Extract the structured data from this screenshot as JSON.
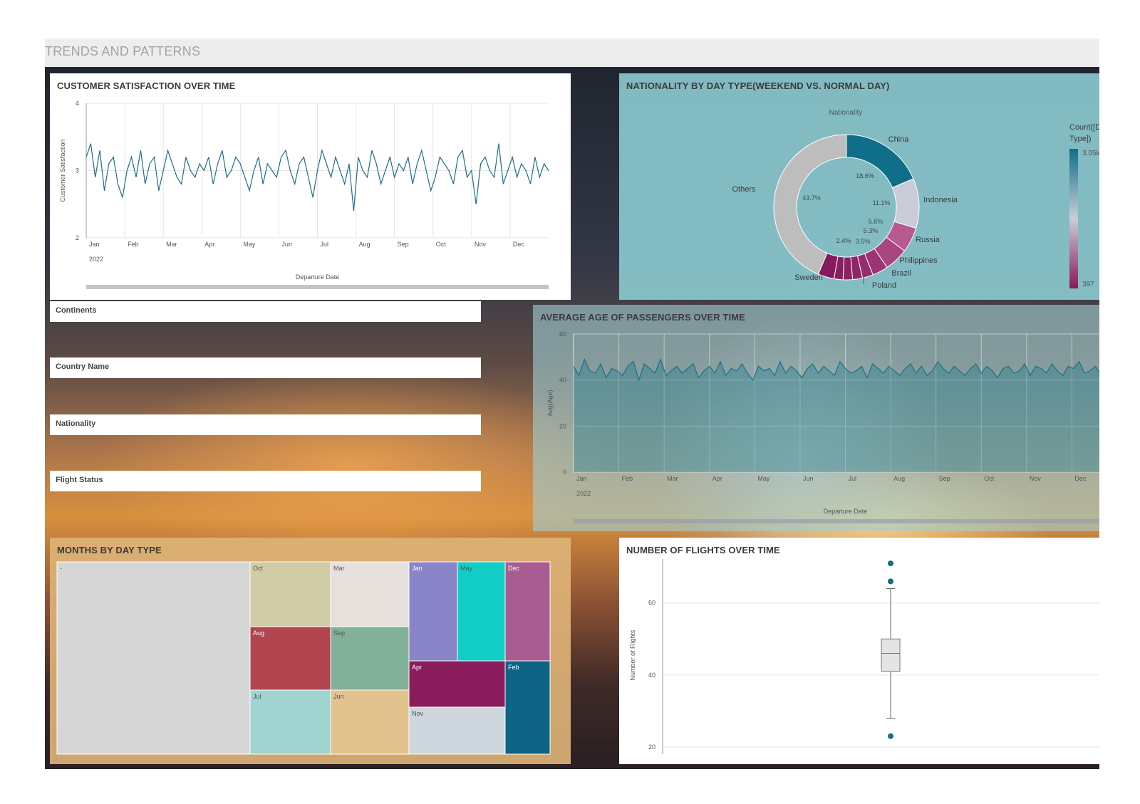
{
  "header": {
    "title": "TRENDS AND PATTERNS"
  },
  "filters": [
    {
      "label": "Continents"
    },
    {
      "label": "Country Name"
    },
    {
      "label": "Nationality"
    },
    {
      "label": "Flight Status"
    }
  ],
  "colors": {
    "accent": "#0f6f8a",
    "magenta": "#8a1a5a",
    "panel_teal": "#8ac8cd",
    "treemap_bg": "#ddb276"
  },
  "chart_data": [
    {
      "id": "customer_satisfaction",
      "type": "line",
      "title": "CUSTOMER SATISFACTION OVER TIME",
      "xlabel": "Departure Date",
      "ylabel": "Customer Satisfaction",
      "x_ticks": [
        "Jan",
        "Feb",
        "Mar",
        "Apr",
        "May",
        "Jun",
        "Jul",
        "Aug",
        "Sep",
        "Oct",
        "Nov",
        "Dec"
      ],
      "x_year": "2022",
      "y_ticks": [
        2,
        3,
        4
      ],
      "ylim": [
        2,
        4
      ],
      "grid": true,
      "series": [
        {
          "values": [
            3.2,
            3.4,
            2.9,
            3.3,
            2.7,
            3.1,
            3.2,
            2.8,
            2.6,
            3.0,
            3.2,
            2.9,
            3.3,
            2.8,
            3.1,
            3.2,
            2.7,
            3.0,
            3.3,
            3.1,
            2.9,
            2.8,
            3.2,
            3.0,
            2.9,
            3.1,
            3.0,
            3.2,
            2.8,
            3.1,
            3.3,
            2.9,
            3.0,
            3.2,
            3.1,
            2.9,
            2.7,
            3.0,
            3.2,
            2.8,
            3.1,
            3.0,
            2.9,
            3.2,
            3.3,
            3.0,
            2.8,
            3.1,
            3.2,
            2.9,
            2.6,
            3.0,
            3.3,
            3.1,
            2.9,
            3.2,
            3.0,
            2.8,
            3.1,
            2.4,
            3.2,
            3.0,
            2.9,
            3.3,
            3.1,
            2.8,
            3.0,
            3.2,
            2.9,
            3.1,
            3.0,
            3.2,
            2.8,
            3.1,
            3.3,
            3.0,
            2.7,
            2.9,
            3.2,
            3.1,
            3.0,
            2.8,
            3.2,
            3.3,
            2.9,
            3.0,
            2.5,
            3.1,
            3.2,
            3.0,
            2.9,
            3.4,
            2.8,
            3.0,
            3.2,
            2.9,
            3.1,
            3.0,
            2.8,
            3.2,
            2.9,
            3.1,
            3.0
          ]
        }
      ]
    },
    {
      "id": "nationality_donut",
      "type": "pie",
      "title": "NATIONALITY BY DAY TYPE(WEEKEND VS. NORMAL DAY)",
      "subtitle": "Nationality",
      "legend_title": "Count([Day Type])",
      "legend_max": "3.05k",
      "legend_min": "397",
      "slices": [
        {
          "label": "China",
          "pct": 18.6,
          "pct_label": "18.6%",
          "color": "#0f6f8a"
        },
        {
          "label": "Indonesia",
          "pct": 11.1,
          "pct_label": "11.1%",
          "color": "#c9ccd8"
        },
        {
          "label": "Russia",
          "pct": 5.6,
          "pct_label": "5.6%",
          "color": "#b65a8f"
        },
        {
          "label": "Philippines",
          "pct": 5.3,
          "pct_label": "5.3%",
          "color": "#a84682"
        },
        {
          "label": "Brazil",
          "pct": 3.5,
          "pct_label": "3.5%",
          "color": "#9c3574"
        },
        {
          "label": "Poland",
          "pct": 2.4,
          "pct_label": "2.4%",
          "color": "#952c6c"
        },
        {
          "label": "",
          "pct": 2.2,
          "pct_label": "",
          "color": "#902668"
        },
        {
          "label": "",
          "pct": 2.1,
          "pct_label": "",
          "color": "#8c2264"
        },
        {
          "label": "",
          "pct": 2.0,
          "pct_label": "",
          "color": "#891e61"
        },
        {
          "label": "Sweden",
          "pct": 3.6,
          "pct_label": "",
          "color": "#851a5d"
        },
        {
          "label": "Others",
          "pct": 43.7,
          "pct_label": "43.7%",
          "color": "#bdbdbd"
        }
      ]
    },
    {
      "id": "average_age",
      "type": "area",
      "title": "AVERAGE AGE OF PASSENGERS OVER TIME",
      "xlabel": "Departure Date",
      "ylabel": "Avg(Age)",
      "x_ticks": [
        "Jan",
        "Feb",
        "Mar",
        "Apr",
        "May",
        "Jun",
        "Jul",
        "Aug",
        "Sep",
        "Oct",
        "Nov",
        "Dec"
      ],
      "x_year": "2022",
      "y_ticks": [
        0,
        20,
        40,
        60
      ],
      "ylim": [
        0,
        60
      ],
      "grid": true,
      "series": [
        {
          "values": [
            46,
            42,
            49,
            44,
            43,
            47,
            41,
            45,
            44,
            42,
            46,
            48,
            40,
            47,
            45,
            43,
            49,
            42,
            44,
            46,
            43,
            45,
            47,
            41,
            44,
            46,
            43,
            48,
            42,
            45,
            44,
            47,
            43,
            40,
            46,
            44,
            45,
            42,
            48,
            43,
            46,
            44,
            41,
            45,
            47,
            43,
            46,
            44,
            42,
            48,
            45,
            43,
            44,
            46,
            41,
            47,
            45,
            43,
            46,
            44,
            42,
            45,
            47,
            43,
            46,
            42,
            44,
            48,
            45,
            43,
            46,
            44,
            42,
            45,
            47,
            43,
            46,
            44,
            41,
            45,
            46,
            43,
            44,
            47,
            42,
            46,
            45,
            43,
            47,
            44,
            42,
            46,
            45,
            48,
            43,
            44,
            46,
            42,
            45,
            47,
            43
          ]
        }
      ]
    },
    {
      "id": "months_treemap",
      "type": "heatmap",
      "title": "MONTHS BY DAY TYPE",
      "cells": [
        {
          "label": "-",
          "color": "#d6d6d6"
        },
        {
          "label": "Oct",
          "color": "#cfcca6"
        },
        {
          "label": "Mar",
          "color": "#e6e0dc"
        },
        {
          "label": "Aug",
          "color": "#b0454f"
        },
        {
          "label": "Sep",
          "color": "#82b098"
        },
        {
          "label": "Jul",
          "color": "#9fd4d0"
        },
        {
          "label": "Jun",
          "color": "#e2c28e"
        },
        {
          "label": "Jan",
          "color": "#8a84c8"
        },
        {
          "label": "May",
          "color": "#12cdc6"
        },
        {
          "label": "Dec",
          "color": "#a95c92"
        },
        {
          "label": "Apr",
          "color": "#8a1c5c"
        },
        {
          "label": "Feb",
          "color": "#0e6484"
        },
        {
          "label": "Nov",
          "color": "#cdd5dd"
        }
      ]
    },
    {
      "id": "number_of_flights",
      "type": "box",
      "title": "NUMBER OF FLIGHTS OVER TIME",
      "ylabel": "Number of Flights",
      "y_ticks": [
        20,
        40,
        60
      ],
      "ylim": [
        18,
        73
      ],
      "grid": true,
      "box": {
        "min": 28,
        "q1": 41,
        "median": 46,
        "q3": 50,
        "max": 64
      },
      "outliers": [
        23,
        66,
        71
      ]
    }
  ]
}
